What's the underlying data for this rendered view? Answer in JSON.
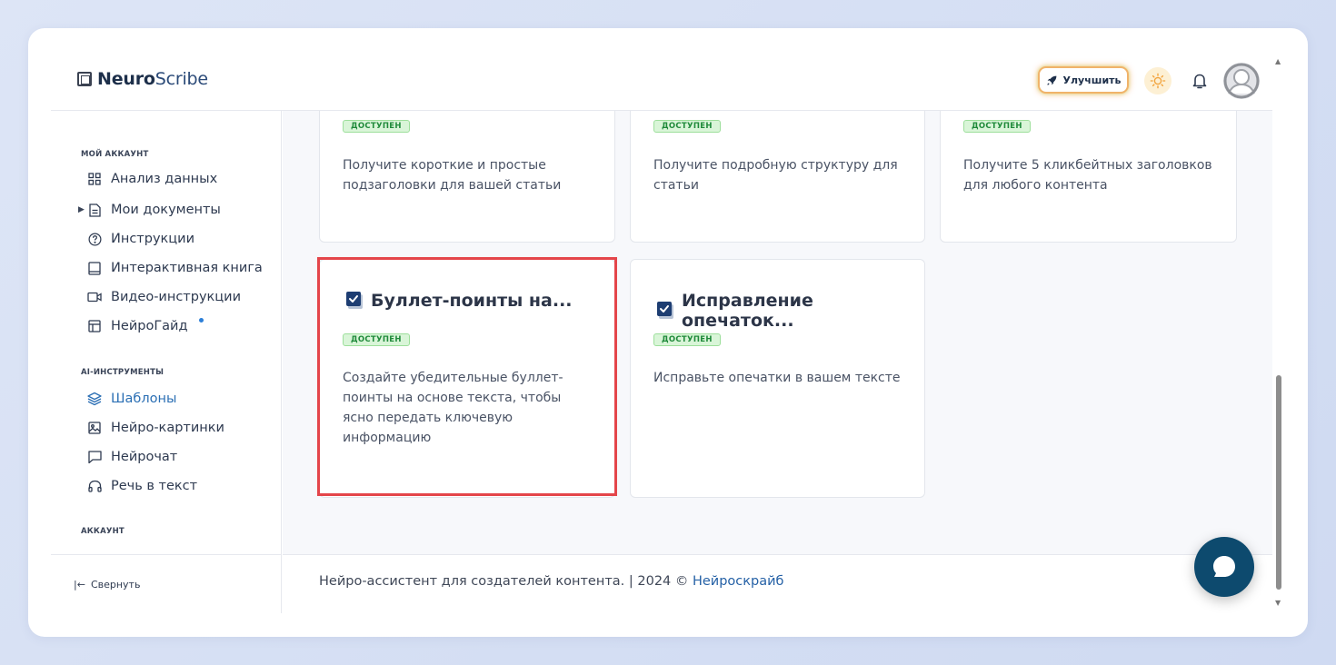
{
  "brand": {
    "bold": "Neuro",
    "light": "Scribe"
  },
  "header": {
    "upgrade_label": "Улучшить"
  },
  "sidebar": {
    "section_account": "МОЙ АККАУНТ",
    "items": [
      {
        "label": "Анализ данных",
        "icon": "grid-icon"
      },
      {
        "label": "Мои документы",
        "icon": "document-icon"
      },
      {
        "label": "Инструкции",
        "icon": "help-circle-icon"
      },
      {
        "label": "Интерактивная книга",
        "icon": "book-icon"
      },
      {
        "label": "Видео-инструкции",
        "icon": "video-icon"
      },
      {
        "label": "НейроГайд",
        "icon": "table-icon"
      }
    ],
    "section_tools": "AI-ИНСТРУМЕНТЫ",
    "tools": [
      {
        "label": "Шаблоны",
        "icon": "layers-icon"
      },
      {
        "label": "Нейро-картинки",
        "icon": "image-icon"
      },
      {
        "label": "Нейрочат",
        "icon": "chat-icon"
      },
      {
        "label": "Речь в текст",
        "icon": "headphones-icon"
      }
    ],
    "section_profile": "АККАУНТ",
    "collapse_label": "Свернуть"
  },
  "cards": [
    {
      "badge": "ДОСТУПЕН",
      "description": "Получите короткие и простые подзаголовки для вашей статьи"
    },
    {
      "badge": "ДОСТУПЕН",
      "description": "Получите подробную структуру для статьи"
    },
    {
      "badge": "ДОСТУПЕН",
      "description": "Получите 5 кликбейтных заголовков для любого контента"
    },
    {
      "title": "Буллет-поинты на...",
      "badge": "ДОСТУПЕН",
      "description": "Создайте убедительные буллет-поинты на основе текста, чтобы ясно передать ключевую информацию"
    },
    {
      "title": "Исправление опечаток...",
      "badge": "ДОСТУПЕН",
      "description": "Исправьте опечатки в вашем тексте"
    }
  ],
  "footer": {
    "text": "Нейро-ассистент для создателей контента.  | 2024 © ",
    "link": "Нейроскрайб"
  },
  "colors": {
    "accent": "#2b6fb4",
    "badge_green": "#1f8a3a",
    "highlight": "#e4454a",
    "chat": "#0d4a6e"
  }
}
